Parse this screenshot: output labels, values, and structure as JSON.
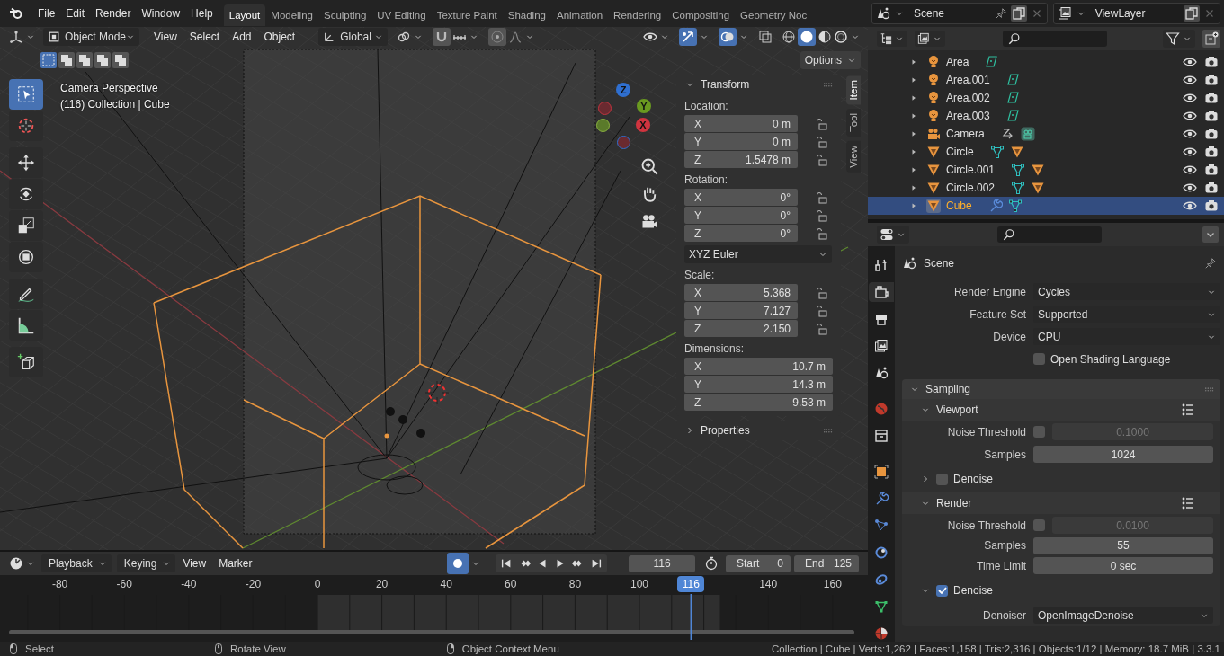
{
  "menu": [
    "File",
    "Edit",
    "Render",
    "Window",
    "Help"
  ],
  "workspaces": [
    {
      "label": "Layout",
      "selected": true
    },
    {
      "label": "Modeling",
      "selected": false
    },
    {
      "label": "Sculpting",
      "selected": false
    },
    {
      "label": "UV Editing",
      "selected": false
    },
    {
      "label": "Texture Paint",
      "selected": false
    },
    {
      "label": "Shading",
      "selected": false
    },
    {
      "label": "Animation",
      "selected": false
    },
    {
      "label": "Rendering",
      "selected": false
    },
    {
      "label": "Compositing",
      "selected": false
    },
    {
      "label": "Geometry Noc",
      "selected": false
    }
  ],
  "viewport": {
    "mode": "Object Mode",
    "menus": [
      "View",
      "Select",
      "Add",
      "Object"
    ],
    "orientation": "Global",
    "options": "Options",
    "select_modes": [
      {
        "selected": true
      },
      {
        "selected": false
      },
      {
        "selected": false
      },
      {
        "selected": false
      },
      {
        "selected": false
      }
    ],
    "info": [
      "Camera Perspective",
      "(116) Collection | Cube"
    ],
    "tools": [
      {
        "kind": "select-box",
        "selected": true
      },
      {
        "kind": "cursor",
        "selected": false
      },
      {
        "kind": "move",
        "selected": false
      },
      {
        "kind": "rotate",
        "selected": false
      },
      {
        "kind": "scale",
        "selected": false
      },
      {
        "kind": "transform",
        "selected": false
      },
      {
        "kind": "annotate",
        "selected": false
      },
      {
        "kind": "measure",
        "selected": false
      },
      {
        "kind": "add-cube",
        "selected": false
      }
    ],
    "gizmo": {
      "x": "X",
      "y": "Y",
      "z": "Z"
    },
    "sidebar_tabs": [
      {
        "label": "Item",
        "selected": true
      },
      {
        "label": "Tool",
        "selected": false
      },
      {
        "label": "View",
        "selected": false
      }
    ]
  },
  "transform": {
    "title": "Transform",
    "expanded": true,
    "groups": [
      {
        "label": "Location:",
        "locks": true,
        "rows": [
          {
            "axis": "X",
            "value": "0 m"
          },
          {
            "axis": "Y",
            "value": "0 m"
          },
          {
            "axis": "Z",
            "value": "1.5478 m"
          }
        ]
      },
      {
        "label": "Rotation:",
        "locks": true,
        "rows": [
          {
            "axis": "X",
            "value": "0°"
          },
          {
            "axis": "Y",
            "value": "0°"
          },
          {
            "axis": "Z",
            "value": "0°"
          }
        ],
        "mode": "XYZ Euler"
      },
      {
        "label": "Scale:",
        "locks": true,
        "rows": [
          {
            "axis": "X",
            "value": "5.368"
          },
          {
            "axis": "Y",
            "value": "7.127"
          },
          {
            "axis": "Z",
            "value": "2.150"
          }
        ]
      },
      {
        "label": "Dimensions:",
        "locks": false,
        "rows": [
          {
            "axis": "X",
            "value": "10.7 m"
          },
          {
            "axis": "Y",
            "value": "14.3 m"
          },
          {
            "axis": "Z",
            "value": "9.53 m"
          }
        ]
      }
    ]
  },
  "properties_panel": {
    "title": "Properties",
    "expanded": false
  },
  "timeline": {
    "menus": [
      {
        "label": "Playback",
        "dropdown": true
      },
      {
        "label": "Keying",
        "dropdown": true
      },
      {
        "label": "View",
        "dropdown": false
      },
      {
        "label": "Marker",
        "dropdown": false
      }
    ],
    "auto_key": true,
    "current_frame": "116",
    "start": {
      "label": "Start",
      "value": "0"
    },
    "end": {
      "label": "End",
      "value": "125"
    },
    "playhead_label": "116",
    "ruler": [
      "-80",
      "-60",
      "-40",
      "-20",
      "0",
      "20",
      "40",
      "60",
      "80",
      "100",
      "140",
      "160"
    ]
  },
  "status": {
    "hints": [
      {
        "kind": "left",
        "text": "Select"
      },
      {
        "kind": "middle",
        "text": "Rotate View"
      },
      {
        "kind": "right",
        "text": "Object Context Menu"
      }
    ],
    "stats": "Collection | Cube | Verts:1,262 | Faces:1,158 | Tris:2,316 | Objects:1/12 | Memory: 18.7 MiB | 3.3.1"
  },
  "scene": "Scene",
  "view_layer": "ViewLayer",
  "outliner": [
    {
      "name": "Area",
      "kind": "light",
      "extras": [
        {
          "kind": "light-data"
        }
      ],
      "expanded": false,
      "selected": false
    },
    {
      "name": "Area.001",
      "kind": "light",
      "extras": [
        {
          "kind": "light-data"
        }
      ],
      "expanded": false,
      "selected": false
    },
    {
      "name": "Area.002",
      "kind": "light",
      "extras": [
        {
          "kind": "light-data"
        }
      ],
      "expanded": false,
      "selected": false
    },
    {
      "name": "Area.003",
      "kind": "light",
      "extras": [
        {
          "kind": "light-data"
        }
      ],
      "expanded": false,
      "selected": false
    },
    {
      "name": "Camera",
      "kind": "camera",
      "extras": [
        {
          "kind": "constraint"
        },
        {
          "kind": "camera-data"
        }
      ],
      "expanded": false,
      "selected": false
    },
    {
      "name": "Circle",
      "kind": "mesh",
      "extras": [
        {
          "kind": "mesh-data"
        },
        {
          "kind": "child-object"
        }
      ],
      "expanded": false,
      "selected": false
    },
    {
      "name": "Circle.001",
      "kind": "mesh",
      "extras": [
        {
          "kind": "mesh-data"
        },
        {
          "kind": "child-object"
        }
      ],
      "expanded": false,
      "selected": false
    },
    {
      "name": "Circle.002",
      "kind": "mesh",
      "extras": [
        {
          "kind": "mesh-data"
        },
        {
          "kind": "child-object"
        }
      ],
      "expanded": false,
      "selected": false
    },
    {
      "name": "Cube",
      "kind": "mesh",
      "extras": [
        {
          "kind": "modifier"
        },
        {
          "kind": "mesh-data"
        }
      ],
      "expanded": false,
      "selected": true
    }
  ],
  "properties": {
    "tabs": [
      {
        "kind": "tool",
        "selected": false
      },
      {
        "kind": "render",
        "selected": true
      },
      {
        "kind": "output",
        "selected": false
      },
      {
        "kind": "view-layer",
        "selected": false
      },
      {
        "kind": "scene",
        "selected": false
      },
      {
        "kind": "world",
        "selected": false
      },
      {
        "kind": "collection",
        "selected": false
      },
      {
        "kind": "object",
        "selected": false
      },
      {
        "kind": "modifier",
        "selected": false
      },
      {
        "kind": "particles",
        "selected": false
      },
      {
        "kind": "physics",
        "selected": false
      },
      {
        "kind": "constraint",
        "selected": false
      },
      {
        "kind": "data",
        "selected": false
      },
      {
        "kind": "material",
        "selected": false
      }
    ],
    "context": "Scene",
    "fields": [
      {
        "label": "Render Engine",
        "value": "Cycles"
      },
      {
        "label": "Feature Set",
        "value": "Supported"
      },
      {
        "label": "Device",
        "value": "CPU"
      }
    ],
    "osl": {
      "label": "Open Shading Language",
      "checked": false
    },
    "panel": {
      "title": "Sampling",
      "expanded": true
    },
    "rows": [
      {
        "kind": "panel",
        "title": "Viewport",
        "expanded": true
      },
      {
        "kind": "toggle-number",
        "label": "Noise Threshold",
        "checked": false,
        "value": "0.1000"
      },
      {
        "kind": "number",
        "label": "Samples",
        "value": "1024"
      },
      {
        "kind": "check-panel",
        "title": "Denoise",
        "checked": false,
        "expanded": false
      },
      {
        "kind": "panel",
        "title": "Render",
        "expanded": true
      },
      {
        "kind": "toggle-number",
        "label": "Noise Threshold",
        "checked": false,
        "value": "0.0100"
      },
      {
        "kind": "number",
        "label": "Samples",
        "value": "55",
        "joined": true
      },
      {
        "kind": "number",
        "label": "Time Limit",
        "value": "0 sec"
      },
      {
        "kind": "check-panel",
        "title": "Denoise",
        "checked": true,
        "expanded": true
      },
      {
        "kind": "dropdown",
        "label": "Denoiser",
        "value": "OpenImageDenoise"
      }
    ]
  }
}
